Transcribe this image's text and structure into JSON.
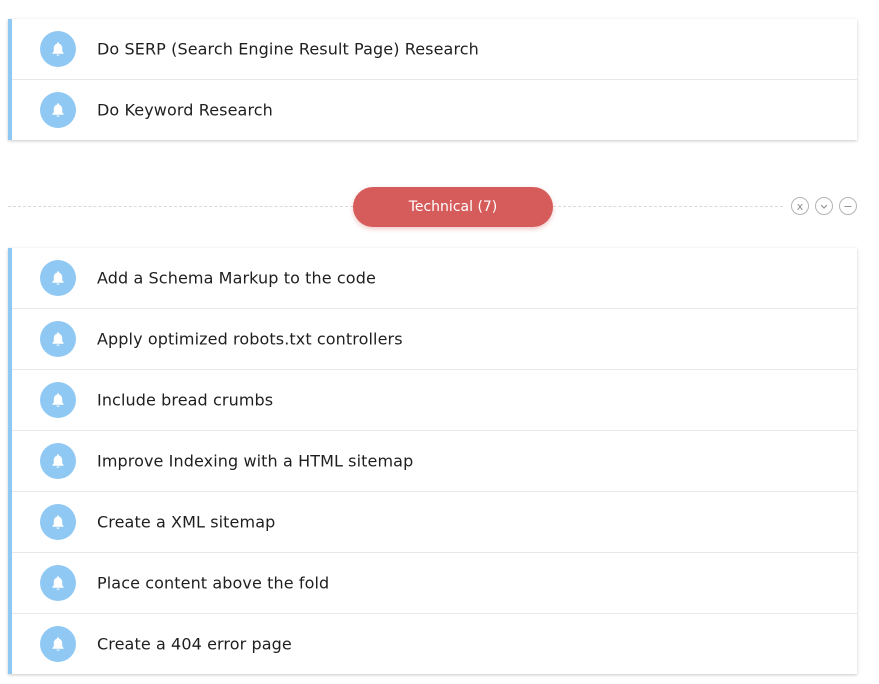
{
  "top_group": {
    "items": [
      {
        "label": "Do SERP (Search Engine Result Page) Research"
      },
      {
        "label": "Do Keyword Research"
      }
    ]
  },
  "technical_group": {
    "title": "Technical (7)",
    "actions": {
      "close": "x",
      "expand": "⌄",
      "collapse": "−"
    },
    "items": [
      {
        "label": "Add a Schema Markup to the code"
      },
      {
        "label": "Apply optimized robots.txt controllers"
      },
      {
        "label": "Include bread crumbs"
      },
      {
        "label": "Improve Indexing with a HTML sitemap"
      },
      {
        "label": "Create a XML sitemap"
      },
      {
        "label": "Place content above the fold"
      },
      {
        "label": "Create a 404 error page"
      }
    ]
  },
  "colors": {
    "accent_blue": "#90c8f4",
    "group_red": "#d55c5b"
  },
  "icons": {
    "task": "bell-icon"
  }
}
